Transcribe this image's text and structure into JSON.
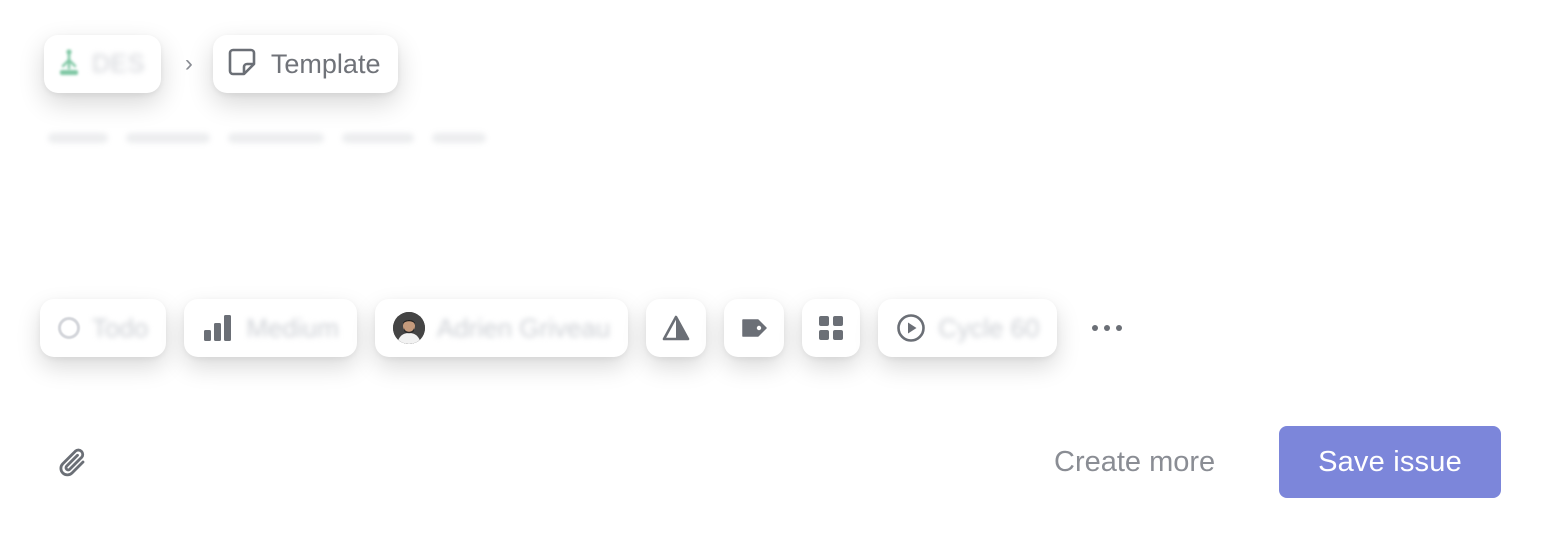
{
  "breadcrumb": {
    "team_label": "DES",
    "separator": "›",
    "template_label": "Template"
  },
  "properties": {
    "status_label": "Todo",
    "priority_label": "Medium",
    "assignee_label": "Adrien Griveau",
    "cycle_label": "Cycle 60",
    "more_label": "•••"
  },
  "footer": {
    "create_more_label": "Create more",
    "save_label": "Save issue"
  },
  "colors": {
    "accent": "#7c86da",
    "team_icon": "#7fc7a4",
    "icon_gray": "#6b6f76"
  },
  "icons": {
    "team": "team-tree-icon",
    "template": "sticky-note-icon",
    "status": "circle-status-icon",
    "priority": "signal-bars-icon",
    "estimate": "triangle-estimate-icon",
    "label": "tag-icon",
    "project": "grid-icon",
    "cycle": "play-circle-icon",
    "attach": "paperclip-icon"
  }
}
